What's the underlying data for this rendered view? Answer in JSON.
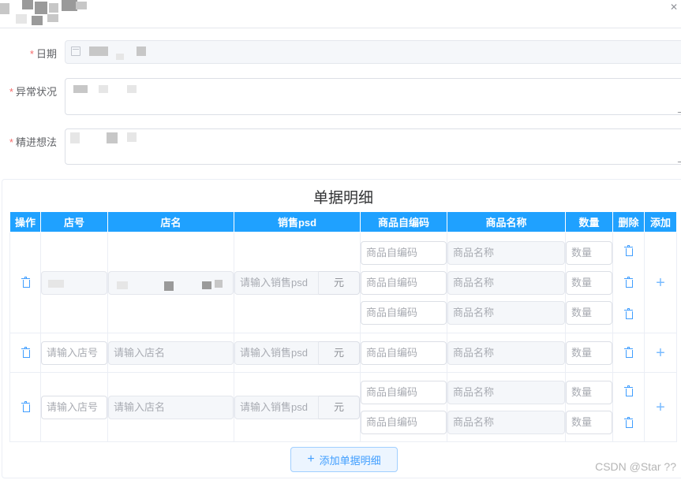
{
  "form": {
    "date_label": "日期",
    "issue_label": "异常状况",
    "idea_label": "精进想法",
    "required_mark": "*"
  },
  "detail": {
    "title": "单据明细",
    "headers": [
      "操作",
      "店号",
      "店名",
      "销售psd",
      "商品自编码",
      "商品名称",
      "数量",
      "删除",
      "添加"
    ],
    "store_no_placeholder": "请输入店号",
    "store_name_placeholder": "请输入店名",
    "sales_placeholder": "请输入销售psd",
    "unit": "元",
    "item_code_placeholder": "商品自编码",
    "item_name_placeholder": "商品名称",
    "qty_placeholder": "数量",
    "groups": [
      {
        "item_rows": 3,
        "store_filled": true
      },
      {
        "item_rows": 1,
        "store_filled": false
      },
      {
        "item_rows": 2,
        "store_filled": false
      }
    ],
    "add_button_label": "添加单据明细"
  },
  "watermark": "CSDN @Star ??",
  "colors": {
    "header_bg": "#1fa1ff",
    "required": "#f56c6c",
    "primary": "#409eff"
  }
}
